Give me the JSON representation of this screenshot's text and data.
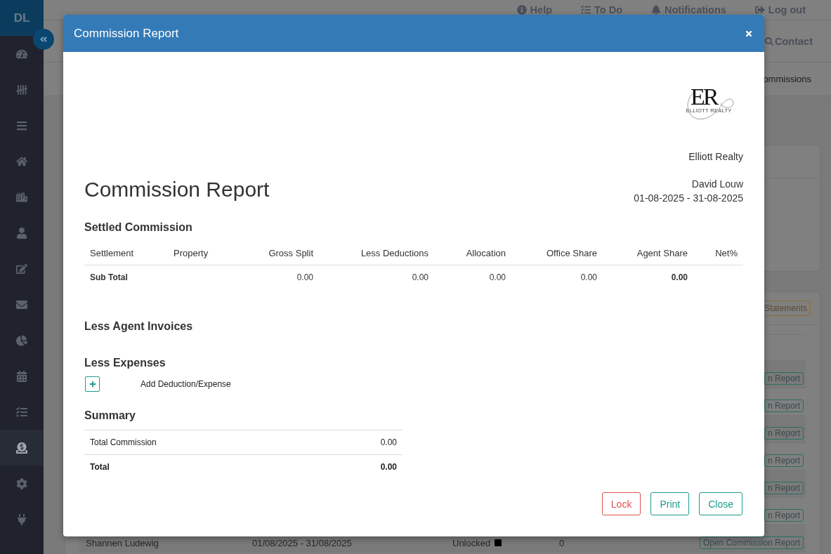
{
  "sidebar": {
    "avatar": "DL",
    "items": [
      {
        "selected": false
      },
      {
        "selected": false
      },
      {
        "selected": false
      },
      {
        "selected": false
      },
      {
        "selected": false
      },
      {
        "selected": false
      },
      {
        "selected": false
      },
      {
        "selected": false
      },
      {
        "selected": false
      },
      {
        "selected": false
      },
      {
        "selected": false
      },
      {
        "selected": true
      },
      {
        "selected": false
      },
      {
        "selected": false
      }
    ]
  },
  "top_bar": {
    "links": [
      {
        "label": "Help"
      },
      {
        "label": "To Do"
      },
      {
        "label": "Notifications"
      },
      {
        "label": "Log out"
      }
    ]
  },
  "search": {
    "label": "Contact"
  },
  "breadcrumb": {
    "current": "ommissions"
  },
  "content": {
    "statements_button": "Statements",
    "table": {
      "rows": [
        {
          "action": "n Report"
        },
        {
          "action": "n Report"
        },
        {
          "action": "n Report"
        },
        {
          "action": "n Report"
        },
        {
          "action": "n Report"
        },
        {
          "action": "n Report"
        },
        {
          "column_1": "Shannen Ludewig",
          "column_2": "01/08/2025 - 31/08/2025",
          "column_3": "Unlocked",
          "column_4": "0",
          "action": "Open Commission Report"
        }
      ]
    }
  },
  "modal": {
    "title": "Commission Report",
    "logo": {
      "monogram": "ER",
      "tagline": "ELLIOTT REALTY"
    },
    "company": "Elliott Realty",
    "heading": "Commission Report",
    "agent": "David Louw",
    "period": "01-08-2025 - 31-08-2025",
    "settled": {
      "title": "Settled Commission",
      "columns": [
        "Settlement",
        "Property",
        "Gross Split",
        "Less Deductions",
        "Allocation",
        "Office Share",
        "Agent Share",
        "Net%"
      ],
      "sub_total": {
        "label": "Sub Total",
        "cells": [
          {
            "value": "0.00",
            "emphasis": false
          },
          {
            "value": "0.00",
            "emphasis": false
          },
          {
            "value": "0.00",
            "emphasis": false
          },
          {
            "value": "0.00",
            "emphasis": false
          },
          {
            "value": "0.00",
            "emphasis": true
          }
        ]
      }
    },
    "agent_invoices": {
      "title": "Less Agent Invoices"
    },
    "expenses": {
      "title": "Less Expenses",
      "add_label": "Add Deduction/Expense"
    },
    "summary": {
      "title": "Summary",
      "rows": [
        {
          "label": "Total Commission",
          "value": "0.00",
          "kind": "item"
        },
        {
          "label": "Total",
          "value": "0.00",
          "kind": "total"
        }
      ]
    },
    "buttons": [
      {
        "label": "Lock",
        "kind": "danger"
      },
      {
        "label": "Print",
        "kind": "default"
      },
      {
        "label": "Close",
        "kind": "default"
      }
    ]
  }
}
